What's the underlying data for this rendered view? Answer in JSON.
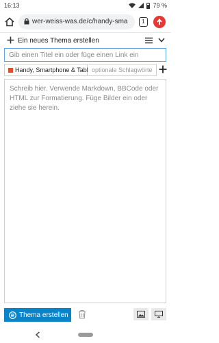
{
  "status_bar": {
    "time": "16:13",
    "battery": "79 %"
  },
  "browser": {
    "url": "wer-weiss-was.de/c/handy-sma",
    "tab_count": "1"
  },
  "composer": {
    "header_title": "Ein neues Thema erstellen",
    "title_placeholder": "Gib einen Titel ein oder füge einen Link ein",
    "category_label": "Handy, Smartphone & Tablet",
    "tags_placeholder": "optionale Schlagwörter",
    "editor_placeholder": "Schreib hier. Verwende Markdown, BBCode oder HTML zur Formatierung. Füge Bilder ein oder ziehe sie herein.",
    "create_button_label": "Thema erstellen"
  },
  "colors": {
    "accent_blue": "#0a84c9",
    "input_focus": "#5aa7e8",
    "category_color": "#e64a2e",
    "menu_red": "#e53935"
  },
  "icons": [
    "home-icon",
    "lock-icon",
    "tab-switcher-icon",
    "browser-menu-icon",
    "plus-icon",
    "hamburger-icon",
    "chevron-down-icon",
    "add-tag-icon",
    "trash-icon",
    "image-upload-icon",
    "preview-icon",
    "back-icon"
  ]
}
